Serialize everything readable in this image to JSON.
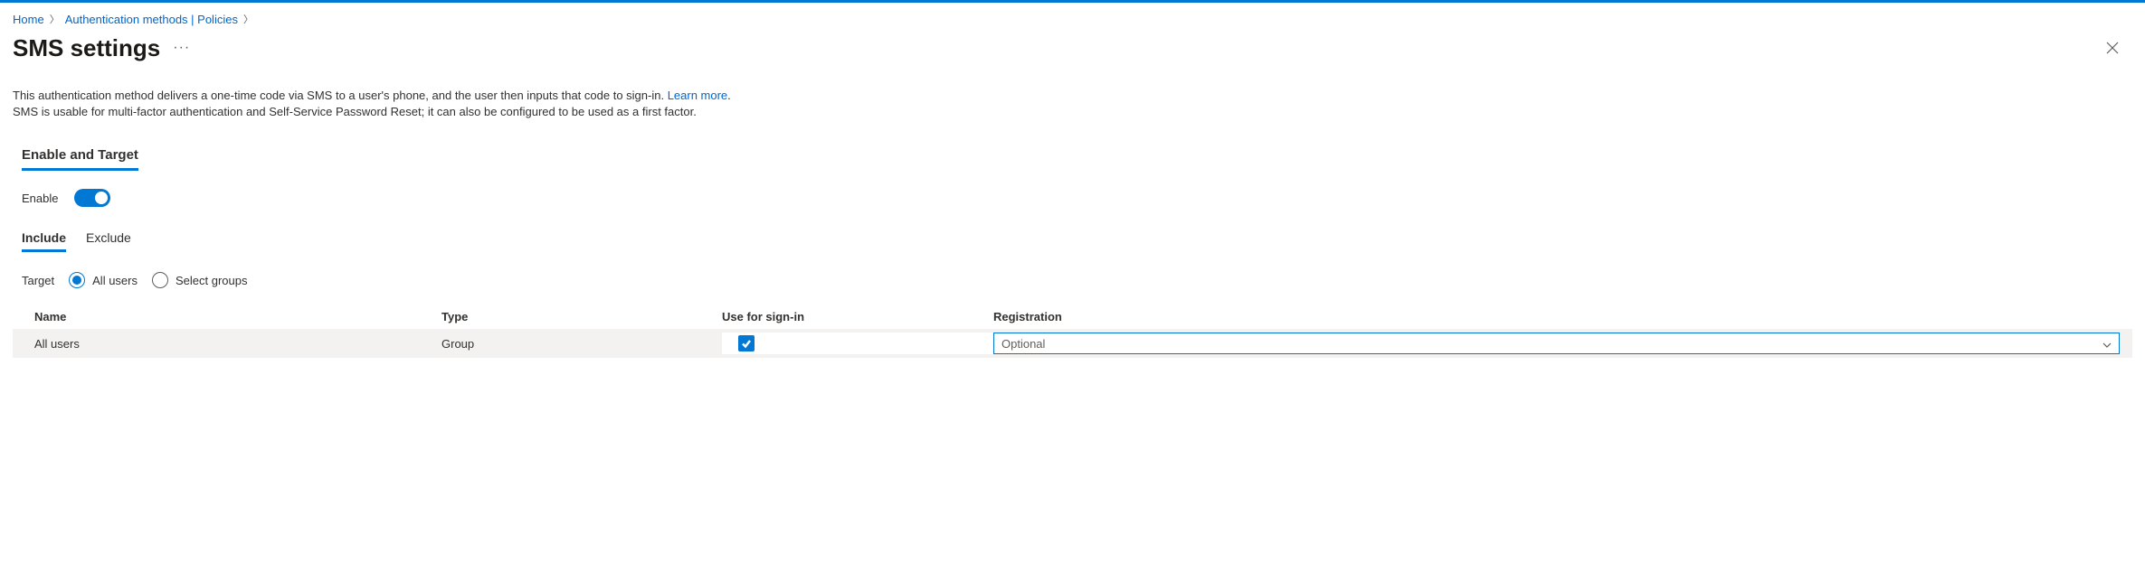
{
  "breadcrumb": {
    "home": "Home",
    "auth": "Authentication methods | Policies"
  },
  "title": "SMS settings",
  "description": {
    "line1_a": "This authentication method delivers a one-time code via SMS to a user's phone, and the user then inputs that code to sign-in. ",
    "learn_more": "Learn more",
    "line1_b": ".",
    "line2": "SMS is usable for multi-factor authentication and Self-Service Password Reset; it can also be configured to be used as a first factor."
  },
  "section_tab": "Enable and Target",
  "enable_label": "Enable",
  "subtabs": {
    "include": "Include",
    "exclude": "Exclude"
  },
  "target_label": "Target",
  "radios": {
    "all_users": "All users",
    "select_groups": "Select groups"
  },
  "columns": {
    "name": "Name",
    "type": "Type",
    "signin": "Use for sign-in",
    "registration": "Registration"
  },
  "row": {
    "name": "All users",
    "type": "Group",
    "registration": "Optional"
  }
}
